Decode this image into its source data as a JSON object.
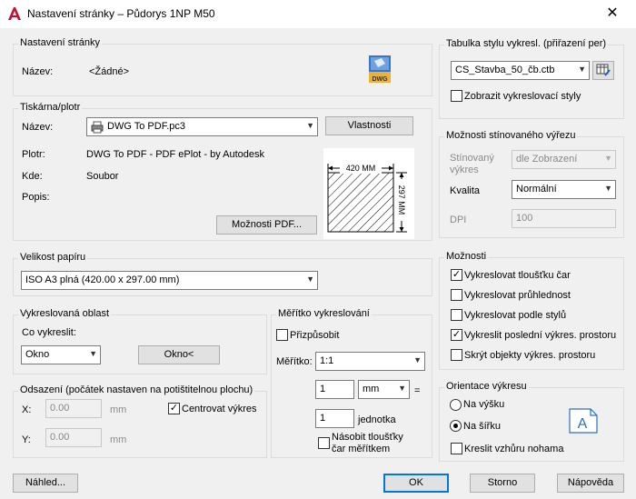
{
  "window": {
    "title": "Nastavení stránky – Půdorys 1NP M50",
    "close": "✕"
  },
  "page_setup": {
    "title": "Nastavení stránky",
    "name_label": "Název:",
    "name_value": "<Žádné>",
    "dwg_label": "DWG"
  },
  "printer": {
    "title": "Tiskárna/plotr",
    "name_label": "Název:",
    "name_value": "DWG To PDF.pc3",
    "properties_button": "Vlastnosti",
    "plotter_label": "Plotr:",
    "plotter_value": "DWG To PDF - PDF ePlot - by Autodesk",
    "where_label": "Kde:",
    "where_value": "Soubor",
    "desc_label": "Popis:",
    "pdf_options_button": "Možnosti PDF...",
    "paper_width": "420 MM",
    "paper_height": "297 MM"
  },
  "paper_size": {
    "title": "Velikost papíru",
    "value": "ISO A3 plná (420.00 x 297.00 mm)"
  },
  "plot_area": {
    "title": "Vykreslovaná oblast",
    "what_label": "Co vykreslit:",
    "what_value": "Okno",
    "window_button": "Okno<"
  },
  "plot_offset": {
    "title": "Odsazení (počátek nastaven na potištitelnou plochu)",
    "x_label": "X:",
    "x_value": "0.00",
    "x_unit": "mm",
    "y_label": "Y:",
    "y_value": "0.00",
    "y_unit": "mm",
    "center_label": "Centrovat výkres",
    "center_checked": true
  },
  "plot_scale": {
    "title": "Měřítko vykreslování",
    "fit_label": "Přizpůsobit",
    "fit_checked": false,
    "scale_label": "Měřítko:",
    "scale_value": "1:1",
    "value1": "1",
    "unit_value": "mm",
    "equals": "=",
    "value2": "1",
    "unit2_label": "jednotka",
    "lineweights_label_1": "Násobit tloušťky",
    "lineweights_label_2": "čar měřítkem",
    "lineweights_checked": false
  },
  "plot_style_table": {
    "title": "Tabulka stylu vykresl. (přiřazení per)",
    "value": "CS_Stavba_50_čb.ctb",
    "display_label": "Zobrazit vykreslovací styly",
    "display_checked": false
  },
  "shaded_viewport": {
    "title": "Možnosti stínovaného výřezu",
    "shaded_label_1": "Stínovaný",
    "shaded_label_2": "výkres",
    "shaded_value": "dle Zobrazení",
    "quality_label": "Kvalita",
    "quality_value": "Normální",
    "dpi_label": "DPI",
    "dpi_value": "100"
  },
  "plot_options": {
    "title": "Možnosti",
    "items": [
      {
        "label": "Vykreslovat tloušťku čar",
        "checked": true
      },
      {
        "label": "Vykreslovat průhlednost",
        "checked": false
      },
      {
        "label": "Vykreslovat podle stylů",
        "checked": false
      },
      {
        "label": "Vykreslit poslední výkres. prostoru",
        "checked": true
      },
      {
        "label": "Skrýt objekty výkres. prostoru",
        "checked": false
      }
    ]
  },
  "orientation": {
    "title": "Orientace výkresu",
    "portrait_label": "Na výšku",
    "landscape_label": "Na šířku",
    "selected": "landscape",
    "upside_label": "Kreslit vzhůru nohama",
    "upside_checked": false,
    "icon_letter": "A"
  },
  "footer": {
    "preview": "Náhled...",
    "ok": "OK",
    "cancel": "Storno",
    "help": "Nápověda"
  },
  "colors": {
    "accent": "#0078d7",
    "autocad_red": "#c8102e"
  }
}
